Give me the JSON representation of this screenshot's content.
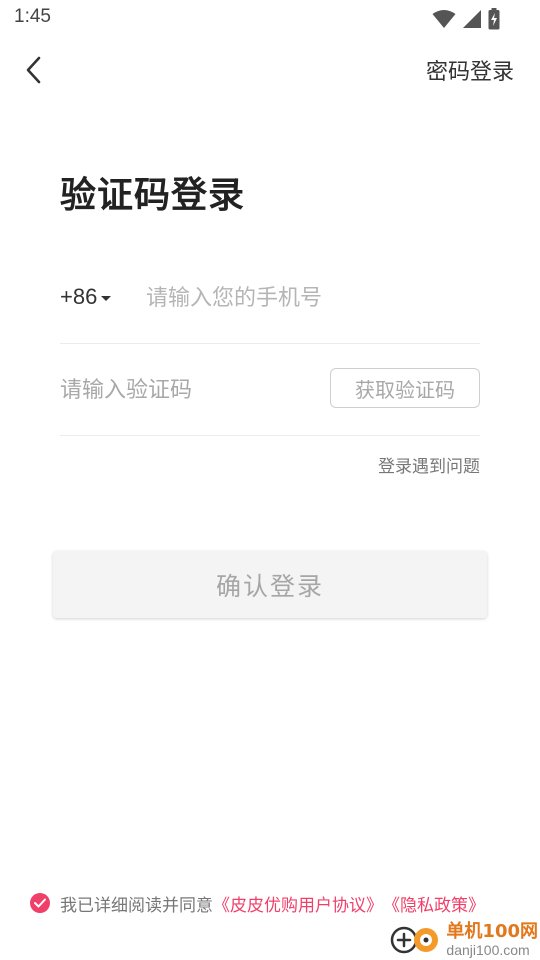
{
  "status_bar": {
    "time": "1:45",
    "icons": [
      "wifi-icon",
      "signal-icon",
      "battery-charging-icon"
    ]
  },
  "topbar": {
    "back_icon": "chevron-left-icon",
    "password_login_label": "密码登录"
  },
  "main": {
    "title": "验证码登录",
    "phone": {
      "country_code": "+86",
      "placeholder": "请输入您的手机号",
      "value": ""
    },
    "code": {
      "placeholder": "请输入验证码",
      "value": "",
      "get_code_label": "获取验证码"
    },
    "login_issue_label": "登录遇到问题",
    "confirm_label": "确认登录"
  },
  "agreement": {
    "checked": true,
    "prefix": "我已详细阅读并同意",
    "user_agreement": "《皮皮优购用户协议》",
    "privacy_policy": "《隐私政策》"
  },
  "watermark": {
    "title": "单机100网",
    "domain": "danji100.com"
  },
  "colors": {
    "accent": "#f0406a",
    "button_bg": "#f4f4f4",
    "placeholder": "#b5b5b5"
  }
}
